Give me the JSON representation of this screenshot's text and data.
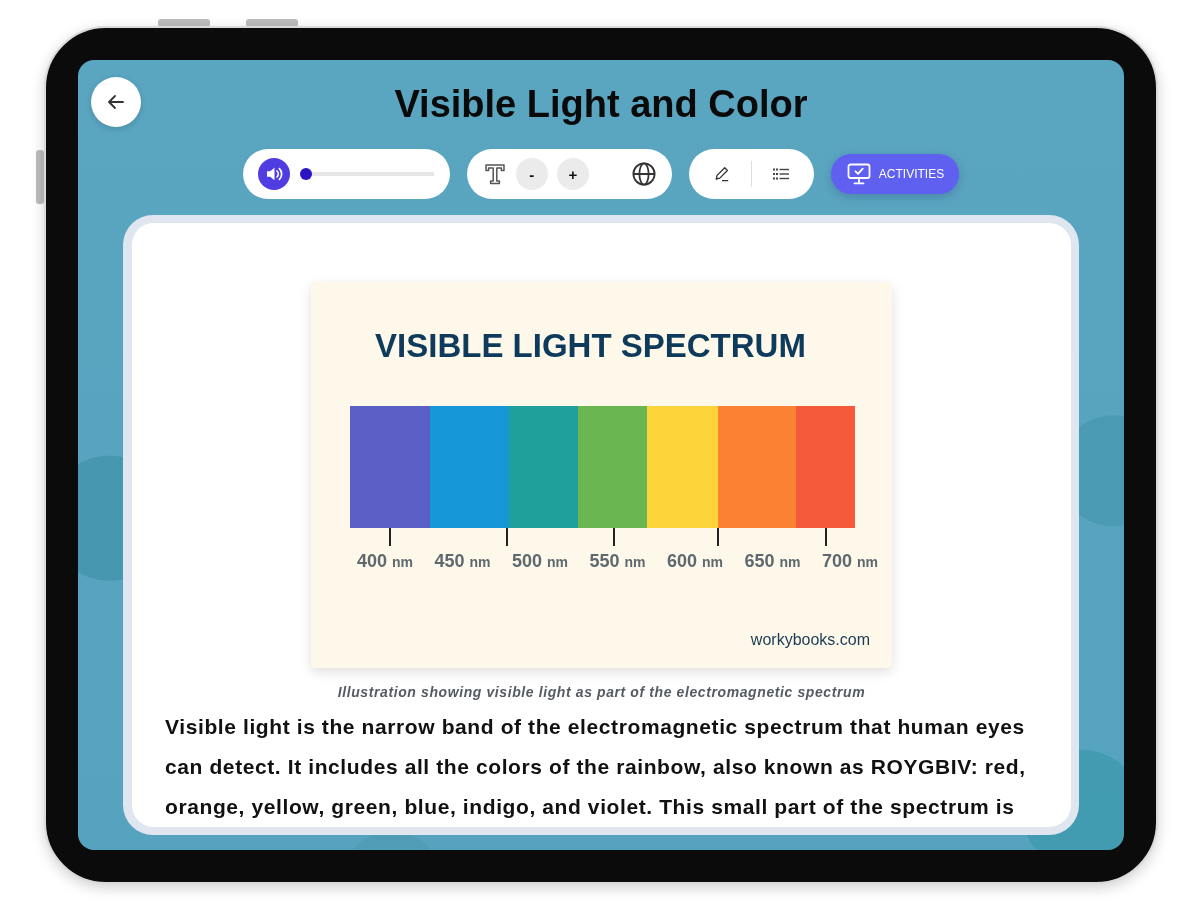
{
  "header": {
    "title": "Visible Light and Color"
  },
  "toolbar": {
    "audio": {
      "level": 0
    },
    "text_size": {
      "decrease": "-",
      "increase": "+"
    },
    "activities_button": {
      "label": "ACTIVITIES"
    }
  },
  "lesson": {
    "illustration": {
      "title": "VISIBLE LIGHT SPECTRUM",
      "bands": [
        {
          "color": "#5b5fc5"
        },
        {
          "color": "#1597d8"
        },
        {
          "color": "#1fa09a"
        },
        {
          "color": "#6ab650"
        },
        {
          "color": "#fdd43a"
        },
        {
          "color": "#fa8232"
        },
        {
          "color": "#f55b3b"
        }
      ],
      "labels": [
        {
          "value": "400",
          "unit": "nm"
        },
        {
          "value": "450",
          "unit": "nm"
        },
        {
          "value": "500",
          "unit": "nm"
        },
        {
          "value": "550",
          "unit": "nm"
        },
        {
          "value": "600",
          "unit": "nm"
        },
        {
          "value": "650",
          "unit": "nm"
        },
        {
          "value": "700",
          "unit": "nm"
        }
      ],
      "credit": "workybooks.com"
    },
    "caption": "Illustration showing visible light as part of the electromagnetic spectrum",
    "paragraph": "Visible light is the narrow band of the electromagnetic spectrum that human eyes can detect. It includes all the colors of the rainbow, also known as ROYGBIV: red, orange, yellow, green, blue, indigo, and violet. This small part of the spectrum is"
  }
}
